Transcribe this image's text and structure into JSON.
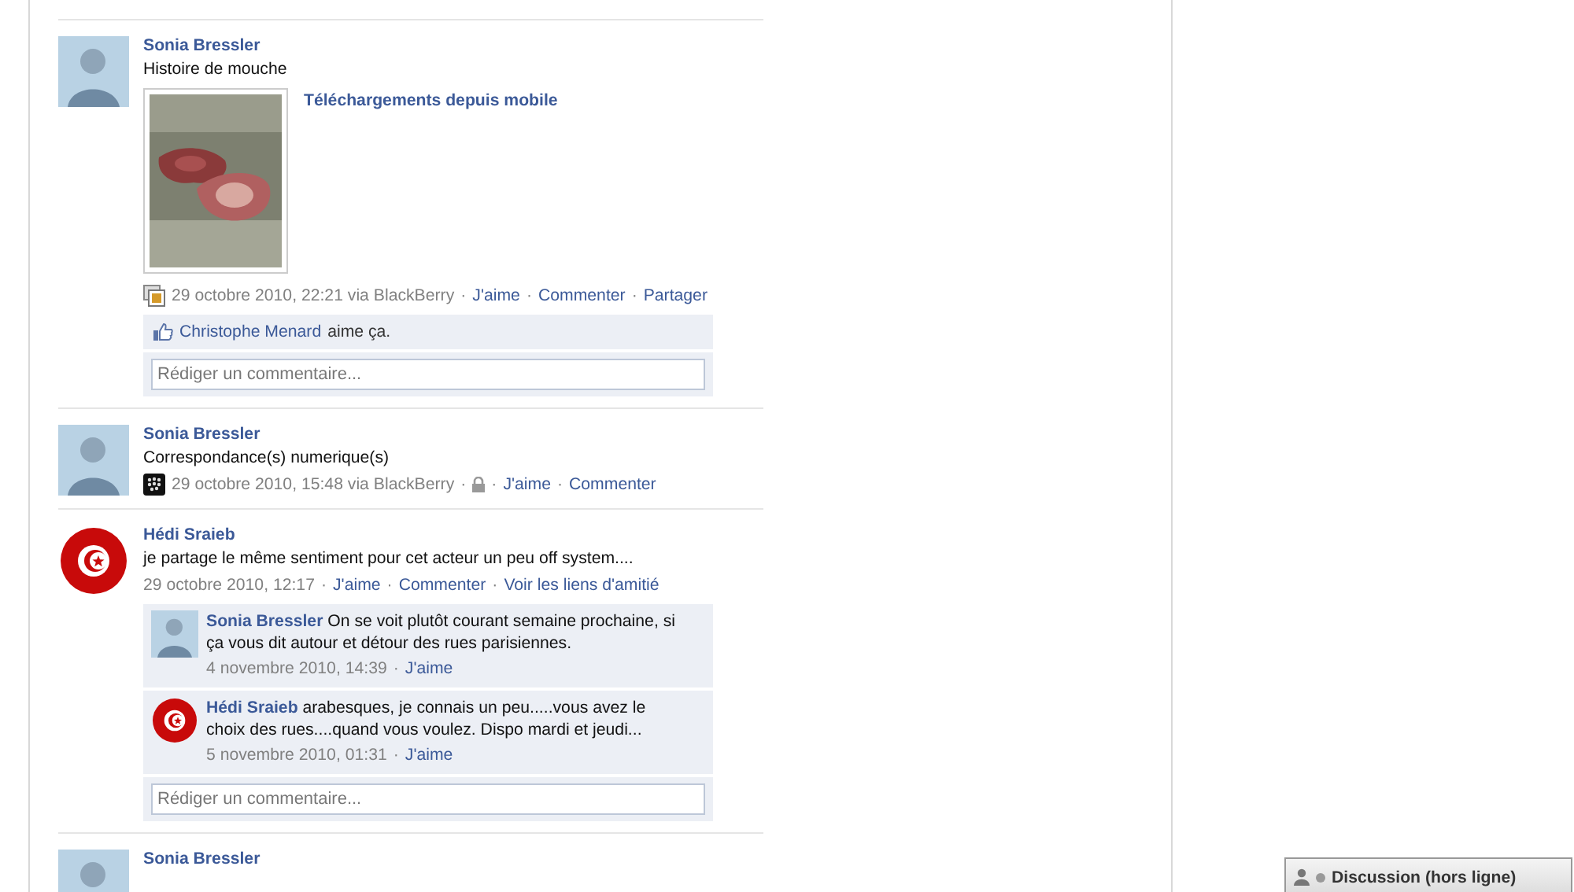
{
  "separator": "·",
  "posts": [
    {
      "author": "Sonia Bressler",
      "avatar": {
        "kind": "person"
      },
      "text": "Histoire de mouche",
      "attachment": {
        "kind": "picture",
        "title": "Téléchargements depuis mobile"
      },
      "meta": {
        "icon": {
          "kind": "photos"
        },
        "time": "29 octobre 2010, 22:21 via BlackBerry",
        "privacy": false,
        "links": [
          {
            "label": "J'aime"
          },
          {
            "label": "Commenter"
          },
          {
            "label": "Partager"
          }
        ]
      },
      "likes": {
        "name": "Christophe Menard",
        "text": "aime ça."
      },
      "comment_placeholder": "Rédiger un commentaire..."
    },
    {
      "author": "Sonia Bressler",
      "avatar": {
        "kind": "person"
      },
      "text": "Correspondance(s) numerique(s)",
      "meta": {
        "icon": {
          "kind": "blackberry"
        },
        "time": "29 octobre 2010, 15:48 via BlackBerry",
        "privacy": true,
        "links": [
          {
            "label": "J'aime"
          },
          {
            "label": "Commenter"
          }
        ]
      }
    },
    {
      "author": "Hédi Sraieb",
      "avatar": {
        "kind": "flag"
      },
      "text": "je partage le même sentiment pour cet acteur un peu off system....",
      "meta": {
        "time": "29 octobre 2010, 12:17",
        "privacy": false,
        "links": [
          {
            "label": "J'aime"
          },
          {
            "label": "Commenter"
          },
          {
            "label": "Voir les liens d'amitié"
          }
        ]
      },
      "comments": [
        {
          "author": "Sonia Bressler",
          "avatar": {
            "kind": "person"
          },
          "text": "On se voit plutôt courant semaine prochaine, si ça vous dit autour et détour des rues parisiennes.",
          "time": "4 novembre 2010, 14:39",
          "links": [
            {
              "label": "J'aime"
            }
          ]
        },
        {
          "author": "Hédi Sraieb",
          "avatar": {
            "kind": "flag"
          },
          "text": "arabesques, je connais un peu.....vous avez le choix des rues....quand vous voulez. Dispo mardi et jeudi...",
          "time": "5 novembre 2010, 01:31",
          "links": [
            {
              "label": "J'aime"
            }
          ]
        }
      ],
      "comment_placeholder": "Rédiger un commentaire..."
    },
    {
      "author": "Sonia Bressler",
      "avatar": {
        "kind": "person"
      }
    }
  ],
  "chat": {
    "label": "Discussion (hors ligne)",
    "online": false
  }
}
